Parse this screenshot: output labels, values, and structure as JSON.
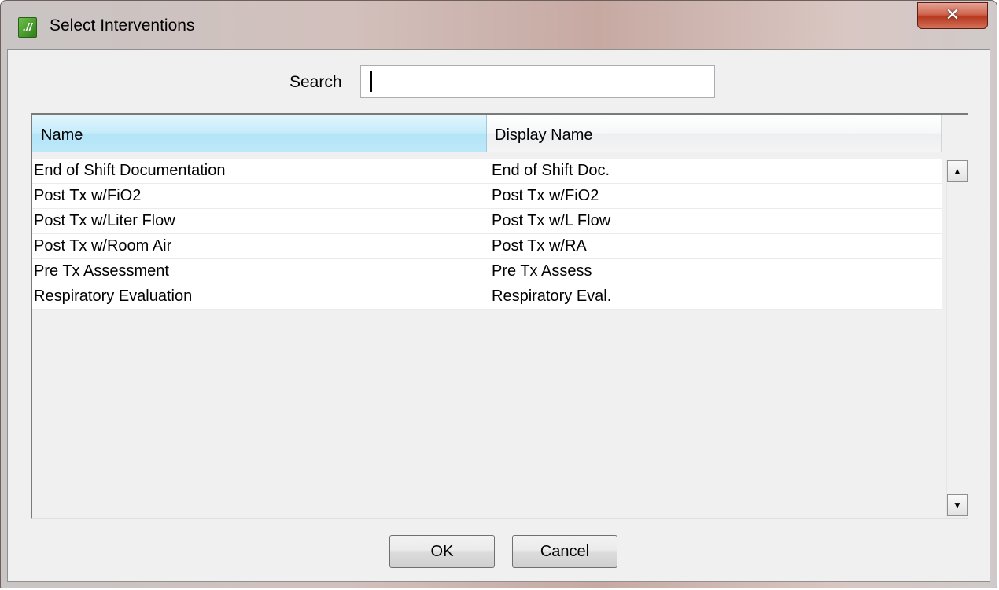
{
  "window": {
    "title": "Select Interventions",
    "app_icon_glyph": ".//",
    "close_glyph": "✕"
  },
  "search": {
    "label": "Search",
    "value": "",
    "placeholder": ""
  },
  "table": {
    "columns": [
      "Name",
      "Display Name"
    ],
    "rows": [
      {
        "name": "End of Shift Documentation",
        "display_name": "End of Shift Doc."
      },
      {
        "name": "Post Tx w/FiO2",
        "display_name": "Post Tx w/FiO2"
      },
      {
        "name": "Post Tx w/Liter Flow",
        "display_name": "Post Tx w/L Flow"
      },
      {
        "name": "Post Tx w/Room Air",
        "display_name": "Post Tx w/RA"
      },
      {
        "name": "Pre Tx Assessment",
        "display_name": "Pre Tx Assess"
      },
      {
        "name": "Respiratory Evaluation",
        "display_name": "Respiratory Eval."
      }
    ],
    "scroll_up_glyph": "▲",
    "scroll_down_glyph": "▼"
  },
  "buttons": {
    "ok_label": "OK",
    "cancel_label": "Cancel"
  }
}
